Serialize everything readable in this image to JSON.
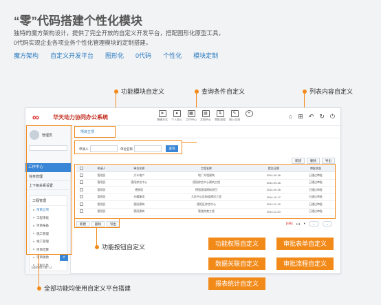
{
  "hero": {
    "title": "“零”代码搭建个性化模块",
    "desc_line1": "独特的魔方架构设计，提供了完全开放的自定义开发平台，搭配图形化原型工具，",
    "desc_line2": "0代码实现企业各项业务个性化管理模块的定制搭建。",
    "tags": [
      "魔方架构",
      "自定义开发平台",
      "图形化",
      "0代码",
      "个性化",
      "模块定制"
    ]
  },
  "callouts": {
    "function_module": "功能模块自定义",
    "query_condition": "查询条件自定义",
    "list_content": "列表内容自定义",
    "function_button": "功能按钮自定义",
    "all_functions": "全部功能均使用自定义平台搭建"
  },
  "app": {
    "title": "华天动力协同办公系统",
    "toolbar": [
      {
        "label": "快捷方式",
        "icon": "send-icon"
      },
      {
        "label": "个人办公",
        "icon": "person-icon"
      },
      {
        "label": "工作中心",
        "icon": "grid-icon"
      },
      {
        "label": "文档中心",
        "icon": "doc-icon"
      },
      {
        "label": "审批流程",
        "icon": "flow-icon"
      },
      {
        "label": "网上交流",
        "icon": "chat-icon"
      }
    ],
    "sidebar": {
      "user": "管理员",
      "main_item": "工作中心",
      "items": [
        "任务管理",
        "上下级关系设置"
      ],
      "group_title": "工程管理",
      "sub_items": [
        "项目立项",
        "工程审核",
        "项目报备",
        "施工管理",
        "竣工管理",
        "项目结算",
        "项目收款",
        "工程信息"
      ],
      "footer": "当前在线人数 1人"
    },
    "tab": "项目立项",
    "filter": {
      "label1": "申请人",
      "label2": "单位名称",
      "button": "查询"
    },
    "actions_top": [
      "新建",
      "删除",
      "导出"
    ],
    "table": {
      "columns": [
        "",
        "申请人",
        "单位名称",
        "工程名称",
        "提交日期",
        "审批状态"
      ],
      "rows": [
        [
          "管理员",
          "大众地产",
          "地厂外墙建筑",
          "2014-09-26",
          "已通过审批"
        ],
        [
          "管理员",
          "德阳综合中心",
          "德阳综合中心建筑工程",
          "2014-09-26",
          "已通过审批"
        ],
        [
          "管理员",
          "德丽医",
          "德丽医楼建筑项目",
          "2014-09-26",
          "已通过审批"
        ],
        [
          "管理员",
          "光耀集团",
          "大区中心区街道建设工程",
          "2014-10-17",
          "已通过审批"
        ],
        [
          "管理员",
          "德阳建筑",
          "德阳区综合中心",
          "2014-11-15",
          "已通过审批"
        ],
        [
          "管理员",
          "德阳建筑",
          "管道完善工程",
          "2014-11-20",
          "已通过审批"
        ]
      ]
    },
    "actions_bottom": [
      "新建",
      "删除",
      "导出"
    ],
    "pager": {
      "total": "[6条]",
      "page": "1/1"
    }
  },
  "feature_buttons": [
    "功能权限自定义",
    "审批表单自定义",
    "数据关联自定义",
    "审批流程自定义",
    "报表统计自定义"
  ],
  "colors": {
    "accent": "#f28a1a",
    "brand_red": "#d7251f",
    "link_blue": "#2a7ac0",
    "nav_blue": "#3a86d6"
  }
}
